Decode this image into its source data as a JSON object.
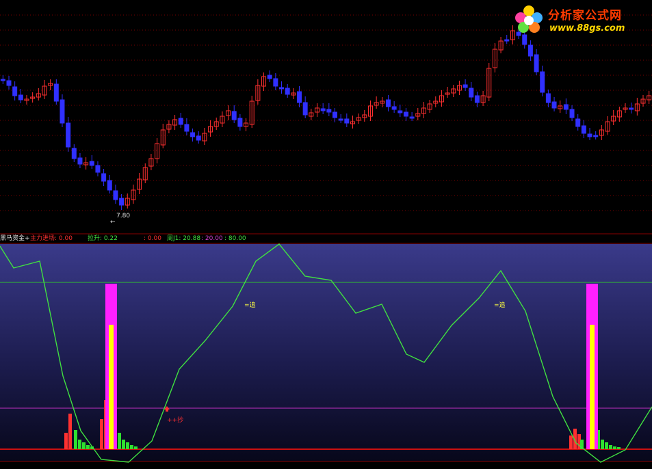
{
  "logo": {
    "title": "分析家公式网",
    "url": "www.88gs.com"
  },
  "price_panel": {
    "low_price_label": "7.80",
    "low_arrow": "←"
  },
  "status_bar": {
    "indicator_name": "黑马资金+",
    "main_inflow_label": "主力进场: 0.00",
    "lift_label": "拉升: 0.22",
    "blank_value": ": 0.00",
    "week_j_label": "周J1: 20.88",
    "level_20": ": 20.00",
    "level_80": ": 80.00"
  },
  "indicator_panel": {
    "chase_label_1": "=追",
    "chase_label_2": "=追",
    "buy_label": "++抄"
  },
  "colors": {
    "up_candle": "#ff3030",
    "down_candle": "#3030ff",
    "gridline": "#7a0000",
    "kdj_line": "#40e040",
    "level_80_line": "#30c030",
    "level_20_line": "#c030c0",
    "magenta_bar": "#ff20ff",
    "yellow_bar": "#ffff00"
  },
  "chart_data": {
    "type": "candlestick-with-indicator",
    "indicator_levels": [
      20,
      80
    ],
    "week_j_current": 20.88,
    "price_low": 7.8
  }
}
